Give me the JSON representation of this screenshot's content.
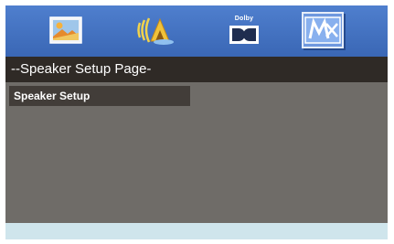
{
  "icons": {
    "tab1": "picture-icon",
    "tab2": "speaker-icon",
    "tab3": "dolby-icon",
    "tab4": "preferences-icon"
  },
  "dolby_label": "Dolby",
  "page_title": "--Speaker Setup Page-",
  "menu": {
    "items": [
      {
        "label": "Speaker  Setup"
      }
    ]
  },
  "colors": {
    "icon_bar": "#3f6dbd",
    "screen_bg": "#6f6c68",
    "title_bar": "#2f2a26",
    "selected_item": "#423d39",
    "footer": "#cfe5ec"
  }
}
